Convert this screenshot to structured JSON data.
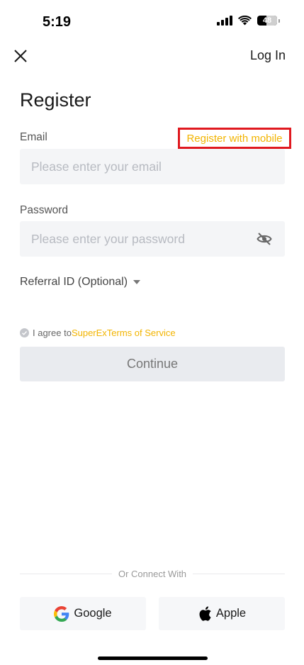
{
  "status_bar": {
    "time": "5:19",
    "battery": "48"
  },
  "nav": {
    "close_icon": "close-icon",
    "login_label": "Log In"
  },
  "page": {
    "title": "Register"
  },
  "form": {
    "email_label": "Email",
    "register_mobile_label": "Register with mobile",
    "email_placeholder": "Please enter your email",
    "password_label": "Password",
    "password_placeholder": "Please enter your password",
    "referral_label": "Referral ID (Optional)",
    "agree_text": "I agree to ",
    "terms_link": "SuperExTerms of Service",
    "continue_label": "Continue"
  },
  "social": {
    "connect_label": "Or Connect With",
    "google_label": "Google",
    "apple_label": "Apple"
  },
  "colors": {
    "accent": "#f2b400",
    "highlight": "#e0191f"
  }
}
